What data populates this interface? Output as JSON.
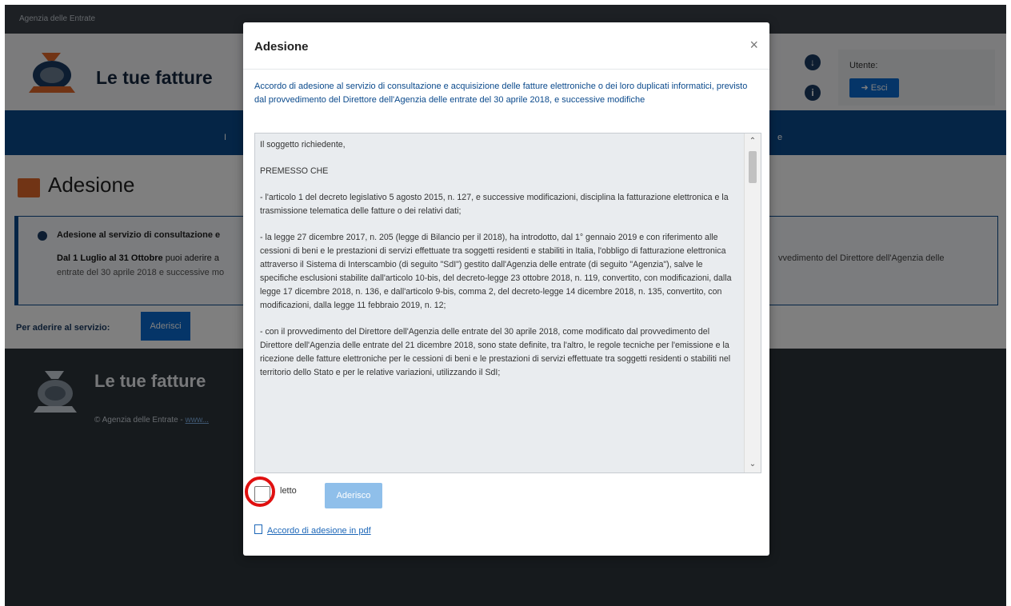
{
  "site": {
    "name": "Agenzia delle Entrate"
  },
  "header": {
    "app_title": "Le tue fatture",
    "user_label": "Utente:",
    "exit_label": "➜ Esci"
  },
  "nav": {
    "left_fragment": "I",
    "right_fragment": "e"
  },
  "page": {
    "title": "Adesione",
    "info_title": "Adesione al servizio di consultazione e",
    "info_dates": "Dal 1 Luglio al 31 Ottobre",
    "info_dates_rest": " puoi aderire a",
    "info_line2": "entrate del 30 aprile 2018 e successive mo",
    "info_right": "vvedimento del Direttore dell'Agenzia delle",
    "aderire_label": "Per aderire al servizio:",
    "aderire_button": "Aderisci"
  },
  "footer": {
    "title": "Le tue fatture",
    "copy": "© Agenzia delle Entrate - ",
    "copy_link": "www..."
  },
  "modal": {
    "title": "Adesione",
    "close_label": "×",
    "intro": "Accordo di adesione al servizio di consultazione e acquisizione delle fatture elettroniche o dei loro duplicati informatici, previsto dal provvedimento del Direttore dell'Agenzia delle entrate del 30 aprile 2018, e successive modifiche",
    "paragraphs": [
      "Il soggetto richiedente,",
      "PREMESSO CHE",
      "- l'articolo 1 del decreto legislativo 5 agosto 2015, n. 127, e successive modificazioni, disciplina la fatturazione elettronica e la trasmissione telematica delle fatture o dei relativi dati;",
      "- la legge 27 dicembre 2017, n. 205 (legge di Bilancio per il 2018), ha introdotto, dal 1° gennaio 2019 e con riferimento alle cessioni di beni e le prestazioni di servizi effettuate tra soggetti residenti e stabiliti in Italia, l'obbligo di fatturazione elettronica attraverso il Sistema di Interscambio (di seguito \"SdI\") gestito dall'Agenzia delle entrate (di seguito \"Agenzia\"), salve le specifiche esclusioni stabilite dall'articolo 10-bis, del decreto-legge 23 ottobre 2018, n. 119, convertito, con modificazioni, dalla legge 17 dicembre 2018, n. 136, e dall'articolo 9-bis, comma 2, del decreto-legge 14 dicembre 2018, n. 135, convertito, con modificazioni, dalla legge 11 febbraio 2019, n. 12;",
      "- con il provvedimento del Direttore dell'Agenzia delle entrate del 30 aprile 2018, come modificato dal provvedimento del Direttore dell'Agenzia delle entrate del 21 dicembre 2018, sono state definite, tra l'altro, le regole tecniche per l'emissione e la ricezione delle fatture elettroniche per le cessioni di beni e le prestazioni di servizi effettuate tra soggetti residenti o stabiliti nel territorio dello Stato e per le relative variazioni, utilizzando il SdI;"
    ],
    "checkbox_label": "letto",
    "submit_label": "Aderisco",
    "pdf_link": "Accordo di adesione in pdf"
  }
}
